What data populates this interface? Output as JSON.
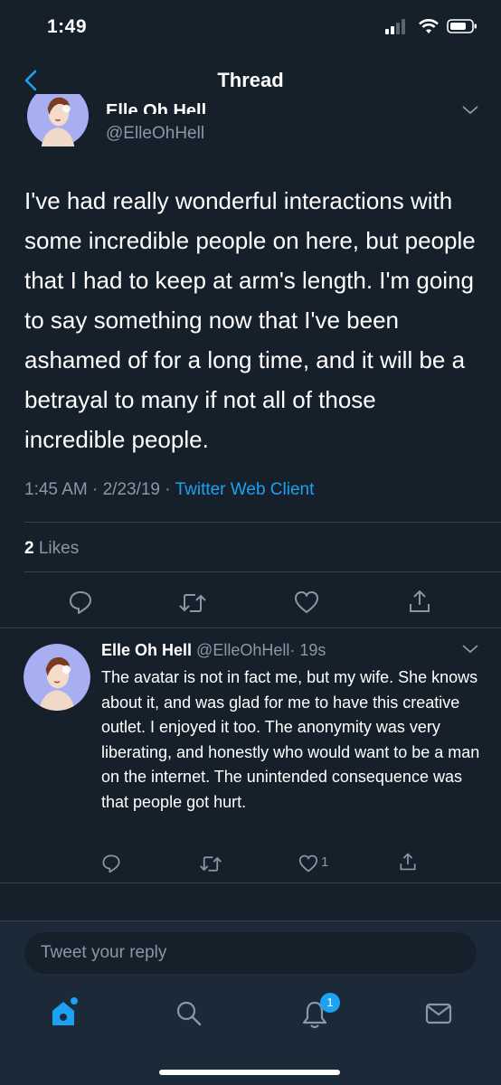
{
  "status_bar": {
    "time": "1:49"
  },
  "header": {
    "title": "Thread"
  },
  "main_tweet": {
    "name": "Elle Oh Hell",
    "handle": "@ElleOhHell",
    "text": "I've had really wonderful interactions with some incredible people on here, but people that I had to keep at arm's length. I'm going to say something now that I've been ashamed of for a long time, and it will be a betrayal to many if not all of those incredible people.",
    "time": "1:45 AM",
    "date": "2/23/19",
    "separator": "·",
    "client": "Twitter Web Client",
    "likes_count": "2",
    "likes_label": "Likes"
  },
  "reply_tweet": {
    "name": "Elle Oh Hell",
    "handle": "@ElleOhHell",
    "age": "· 19s",
    "text": "The avatar is not in fact me, but my wife. She knows about it, and was glad for me to have this creative outlet. I enjoyed it too. The anonymity was very liberating, and honestly who would want to be a man on the internet. The unintended consequence was that people got hurt.",
    "like_count": "1"
  },
  "reply_box": {
    "placeholder": "Tweet your reply"
  },
  "tabbar": {
    "notifications_badge": "1"
  },
  "colors": {
    "background": "#15202b",
    "accent": "#1da1f2",
    "secondary_text": "#8899a6",
    "divider": "#38444d"
  }
}
